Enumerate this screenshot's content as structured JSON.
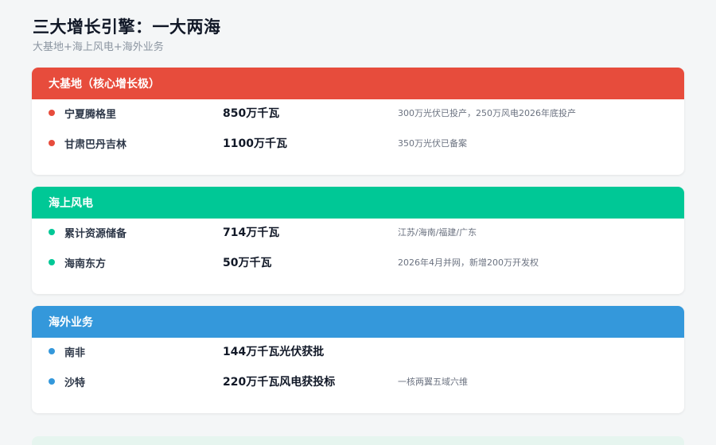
{
  "header": {
    "title": "三大增长引擎：一大两海",
    "subtitle": "大基地+海上风电+海外业务"
  },
  "colors": {
    "base": "#e74c3c",
    "offshore": "#00c896",
    "overseas": "#3498db"
  },
  "cards": [
    {
      "title": "大基地（核心增长极）",
      "rows": [
        {
          "name": "宁夏腾格里",
          "value": "850万千瓦",
          "note": "300万光伏已投产，250万风电2026年底投产"
        },
        {
          "name": "甘肃巴丹吉林",
          "value": "1100万千瓦",
          "note": "350万光伏已备案"
        }
      ]
    },
    {
      "title": "海上风电",
      "rows": [
        {
          "name": "累计资源储备",
          "value": "714万千瓦",
          "note": "江苏/海南/福建/广东"
        },
        {
          "name": "海南东方",
          "value": "50万千瓦",
          "note": "2026年4月并网，新增200万开发权"
        }
      ]
    },
    {
      "title": "海外业务",
      "rows": [
        {
          "name": "南非",
          "value": "144万千瓦光伏获批",
          "note": ""
        },
        {
          "name": "沙特",
          "value": "220万千瓦风电获投标",
          "note": "一核两翼五域六维"
        }
      ]
    }
  ]
}
